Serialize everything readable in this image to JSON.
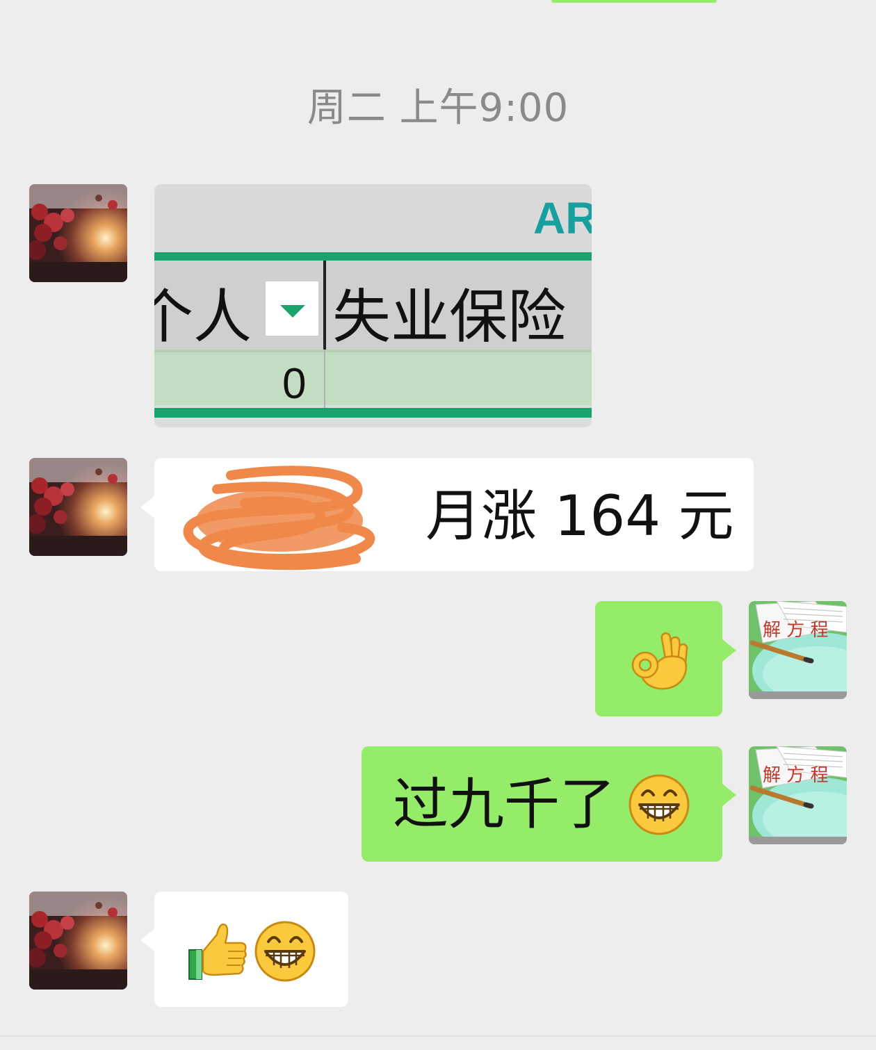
{
  "timestamp": "周二 上午9:00",
  "messages": [
    {
      "side": "left",
      "type": "image",
      "sheet": {
        "header_fragment": "AR",
        "col1_header": "个人",
        "col2_header": "失业保险",
        "cell_value": "0"
      }
    },
    {
      "side": "left",
      "type": "text",
      "text": "月涨 164 元",
      "redacted_prefix": true
    },
    {
      "side": "right",
      "type": "emoji",
      "emoji": "ok-hand"
    },
    {
      "side": "right",
      "type": "text",
      "text": "过九千了",
      "emoji": "grin"
    },
    {
      "side": "left",
      "type": "emoji",
      "emoji": [
        "thumbs-up",
        "grin"
      ]
    }
  ],
  "self_avatar_text": "解 方 程",
  "colors": {
    "background": "#ededed",
    "bubble_self": "#95ec69",
    "bubble_other": "#ffffff",
    "timestamp": "#8a8a8a",
    "sheet_accent": "#1aa36b",
    "redaction": "#f0884a"
  }
}
